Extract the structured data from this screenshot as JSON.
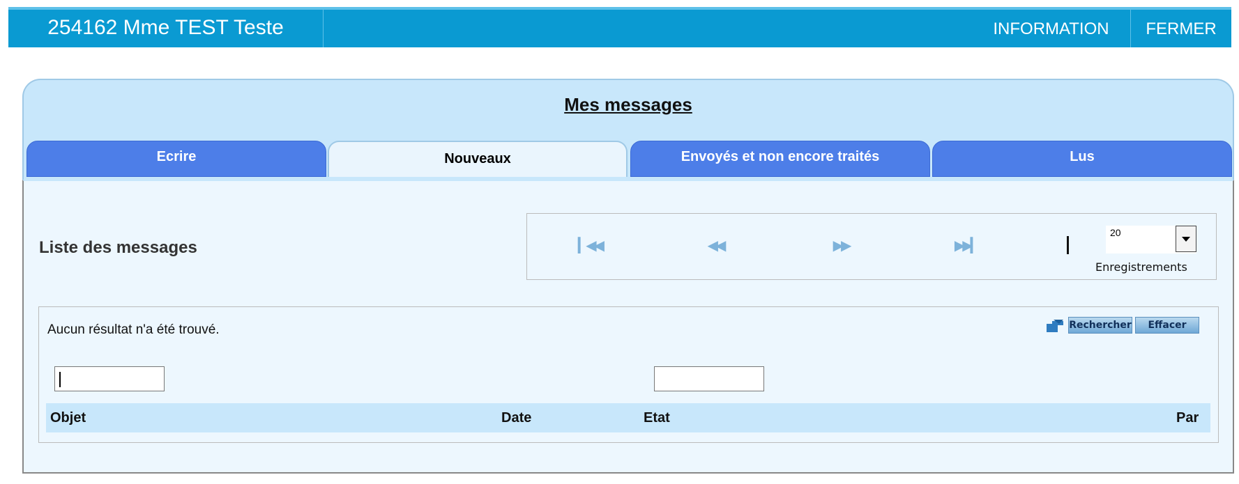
{
  "header": {
    "patient": "254162 Mme TEST Teste",
    "information": "INFORMATION",
    "fermer": "FERMER"
  },
  "page": {
    "title": "Mes messages"
  },
  "tabs": [
    {
      "label": "Ecrire"
    },
    {
      "label": "Nouveaux"
    },
    {
      "label": "Envoyés et non encore traités"
    },
    {
      "label": "Lus"
    }
  ],
  "list": {
    "title": "Liste des messages",
    "page_size": "20",
    "page_size_label": "Enregistrements",
    "no_result": "Aucun résultat n'a été trouvé.",
    "search_button": "Rechercher",
    "clear_button": "Effacer",
    "columns": [
      "Objet",
      "Date",
      "Etat",
      "Par"
    ]
  },
  "icons": {
    "first": "first-page-icon",
    "prev": "previous-page-icon",
    "next": "next-page-icon",
    "last": "last-page-icon",
    "search": "search-arrow-icon"
  },
  "colors": {
    "topbar": "#0a9ad2",
    "panel": "#c8e7fb",
    "tab": "#4d7ee8"
  }
}
